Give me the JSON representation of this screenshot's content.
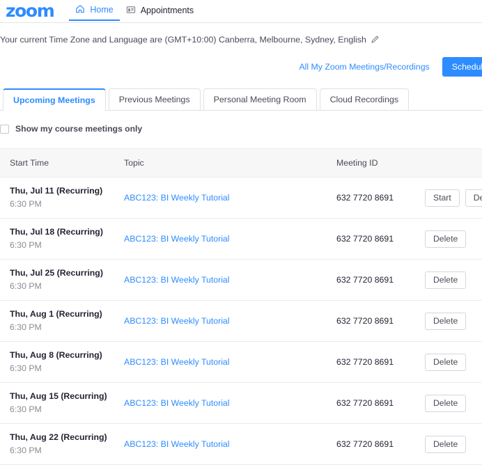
{
  "brand": {
    "logo_text": "zoom",
    "accent_color": "#2d8cff",
    "link_color": "#2d8cff"
  },
  "topnav": {
    "items": [
      {
        "label": "Home",
        "icon": "home-icon",
        "active": true
      },
      {
        "label": "Appointments",
        "icon": "calendar-icon",
        "active": false
      }
    ]
  },
  "timezone": {
    "text": "Your current Time Zone and Language are (GMT+10:00) Canberra, Melbourne, Sydney, English",
    "edit_icon": "pencil-icon"
  },
  "actions": {
    "all_meetings_link": "All My Zoom Meetings/Recordings",
    "schedule_button": "Schedule"
  },
  "tabs": [
    {
      "label": "Upcoming Meetings",
      "active": true
    },
    {
      "label": "Previous Meetings",
      "active": false
    },
    {
      "label": "Personal Meeting Room",
      "active": false
    },
    {
      "label": "Cloud Recordings",
      "active": false
    }
  ],
  "filter": {
    "label": "Show my course meetings only",
    "checked": false
  },
  "table": {
    "columns": [
      "Start Time",
      "Topic",
      "Meeting ID"
    ],
    "rows": [
      {
        "date": "Thu, Jul 11 (Recurring)",
        "time": "6:30 PM",
        "topic": "ABC123: BI Weekly Tutorial",
        "meeting_id": "632 7720 8691",
        "actions": [
          "Start",
          "Delete"
        ]
      },
      {
        "date": "Thu, Jul 18 (Recurring)",
        "time": "6:30 PM",
        "topic": "ABC123: BI Weekly Tutorial",
        "meeting_id": "632 7720 8691",
        "actions": [
          "Delete"
        ]
      },
      {
        "date": "Thu, Jul 25 (Recurring)",
        "time": "6:30 PM",
        "topic": "ABC123: BI Weekly Tutorial",
        "meeting_id": "632 7720 8691",
        "actions": [
          "Delete"
        ]
      },
      {
        "date": "Thu, Aug 1 (Recurring)",
        "time": "6:30 PM",
        "topic": "ABC123: BI Weekly Tutorial",
        "meeting_id": "632 7720 8691",
        "actions": [
          "Delete"
        ]
      },
      {
        "date": "Thu, Aug 8 (Recurring)",
        "time": "6:30 PM",
        "topic": "ABC123: BI Weekly Tutorial",
        "meeting_id": "632 7720 8691",
        "actions": [
          "Delete"
        ]
      },
      {
        "date": "Thu, Aug 15 (Recurring)",
        "time": "6:30 PM",
        "topic": "ABC123: BI Weekly Tutorial",
        "meeting_id": "632 7720 8691",
        "actions": [
          "Delete"
        ]
      },
      {
        "date": "Thu, Aug 22 (Recurring)",
        "time": "6:30 PM",
        "topic": "ABC123: BI Weekly Tutorial",
        "meeting_id": "632 7720 8691",
        "actions": [
          "Delete"
        ]
      }
    ]
  }
}
